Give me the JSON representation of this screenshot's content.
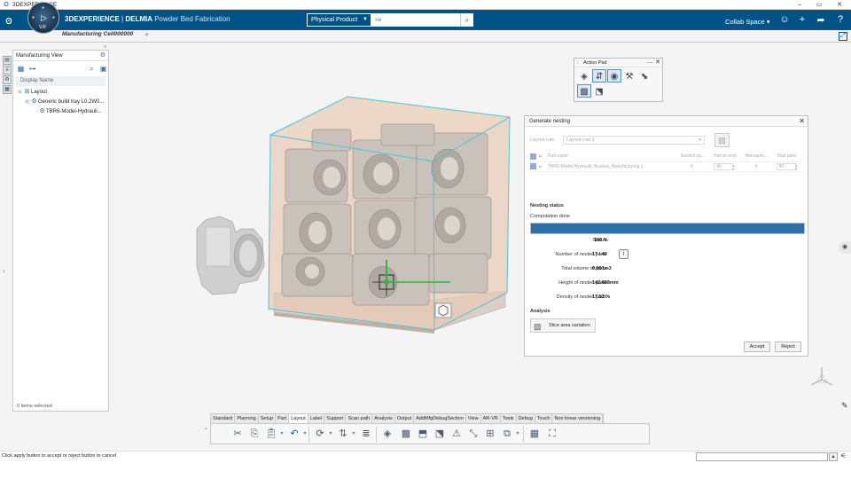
{
  "os": {
    "title": "3DEXPERIENCE",
    "minimize": "–",
    "maximize": "▭",
    "close": "✕"
  },
  "header": {
    "compass_version": "V.R",
    "brand": "3DEXPERIENCE",
    "separator": " | ",
    "app": "DELMIA",
    "app_sub": " Powder Bed Fabrication",
    "product_select": "Physical Product",
    "search_placeholder": "Se",
    "search_icon": "search-icon",
    "collab_space": "Collab Space ▾",
    "colors": {
      "brand_blue": "#005386",
      "cyan_box": "#49c5d3"
    }
  },
  "tabs": {
    "document": "Manufacturing Cell000000",
    "add": "+"
  },
  "tree": {
    "title": "Manufacturing View",
    "filter": "Display Name",
    "nodes": [
      {
        "label": "Layout"
      },
      {
        "label": "Generic build tray L0.2W0..."
      },
      {
        "label": "TBR6-Model-Hydrauli..."
      }
    ],
    "status": "0 items selected"
  },
  "action_pad": {
    "title": "Action Pad"
  },
  "nesting": {
    "title": "Generate nesting",
    "layout_rule_label": "Layout rule",
    "layout_rule_value": "Layout rule.1",
    "columns": [
      "Part name",
      "Nested pa...",
      "Part to nest",
      "Remainin...",
      "Total parts"
    ],
    "rows": [
      {
        "name": "TBR6-Model-Hydraulic Bracket_Manufacturing.1",
        "nested": "0",
        "to_nest": "40",
        "remaining": "0",
        "total": "40"
      }
    ],
    "status_title": "Nesting status",
    "computation": "Computation done",
    "progress": 1.0,
    "stats": {
      "status_label": "Status",
      "status_value": "100 %",
      "nested_label": "Number of nested parts",
      "nested_value": "17 / 40",
      "volume_label": "Total volume of parts",
      "volume_value": "0.001m3",
      "height_label": "Height of nested parts",
      "height_value": "142.688mm",
      "density_label": "Density of nested parts",
      "density_value": "17.52 %"
    },
    "analysis_title": "Analysis",
    "slice_button": "Slice area variation",
    "accept": "Accept",
    "reject": "Reject"
  },
  "toolbar": {
    "tabs": [
      "Standard",
      "Planning",
      "Setup",
      "Part",
      "Layout",
      "Label",
      "Support",
      "Scan path",
      "Analysis",
      "Output",
      "AddMfgDebugSection",
      "View",
      "AR-VR",
      "Tools",
      "Debug",
      "Touch",
      "Non linear versioning"
    ],
    "active_tab": "Layout"
  },
  "status_bar": {
    "message": "Click apply button to accept or reject button to cancel"
  }
}
